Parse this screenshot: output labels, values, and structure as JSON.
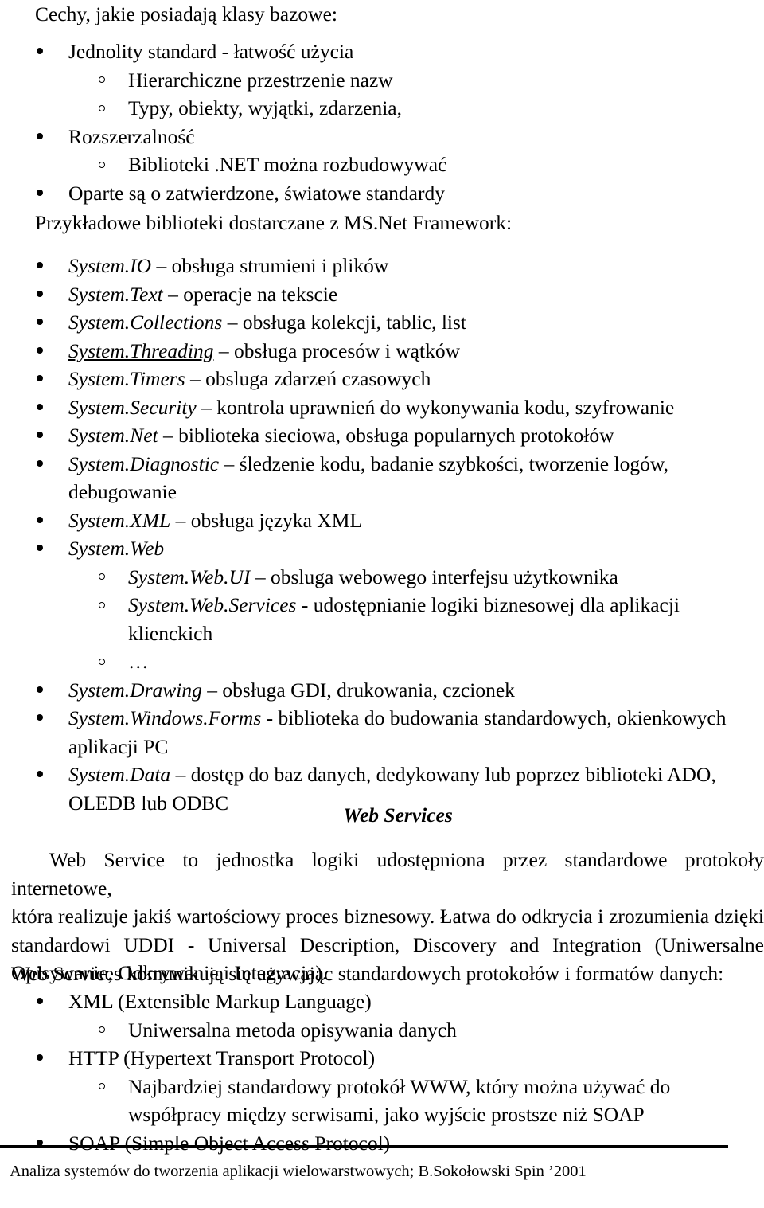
{
  "document": {
    "heading": "Cechy, jakie posiadają klasy bazowe:",
    "framework_intro": "Przykładowe biblioteki dostarczane z MS.Net Framework:",
    "features": [
      {
        "level": 1,
        "text": "Jednolity standard - łatwość użycia"
      },
      {
        "level": 2,
        "text": "Hierarchiczne przestrzenie nazw"
      },
      {
        "level": 2,
        "text": "Typy, obiekty, wyjątki, zdarzenia,"
      },
      {
        "level": 1,
        "text": "Rozszerzalność"
      },
      {
        "level": 2,
        "text": "Biblioteki .NET można rozbudowywać"
      },
      {
        "level": 1,
        "text": "Oparte są o zatwierdzone, światowe standardy"
      }
    ],
    "libraries": [
      {
        "level": 1,
        "name": "System.IO",
        "style": "italic",
        "desc": " – obsługa strumieni i plików"
      },
      {
        "level": 1,
        "name": "System.Text",
        "style": "italic",
        "desc": " – operacje na tekscie"
      },
      {
        "level": 1,
        "name": "System.Collections",
        "style": "italic",
        "desc": " – obsługa kolekcji, tablic, list"
      },
      {
        "level": 1,
        "name": "System.Threading",
        "style": "italic-underline",
        "desc": " – obsługa procesów i wątków"
      },
      {
        "level": 1,
        "name": "System.Timers",
        "style": "italic",
        "desc": " – obsluga zdarzeń czasowych"
      },
      {
        "level": 1,
        "name": "System.Security",
        "style": "italic",
        "desc": " – kontrola uprawnień do wykonywania kodu, szyfrowanie"
      },
      {
        "level": 1,
        "name": "System.Net",
        "style": "italic",
        "desc": " – biblioteka sieciowa, obsługa popularnych protokołów"
      },
      {
        "level": 1,
        "name": "System.Diagnostic",
        "style": "italic",
        "desc": " – śledzenie kodu, badanie szybkości, tworzenie logów, debugowanie"
      },
      {
        "level": 1,
        "name": "System.XML",
        "style": "italic",
        "desc": " – obsługa języka XML"
      },
      {
        "level": 1,
        "name": "System.Web",
        "style": "italic",
        "desc": ""
      },
      {
        "level": 2,
        "name": "System.Web.UI",
        "style": "italic",
        "desc": " – obsluga webowego interfejsu użytkownika"
      },
      {
        "level": 2,
        "name": "System.Web.Services",
        "style": "italic",
        "desc": "  - udostępnianie logiki biznesowej dla aplikacji klienckich"
      },
      {
        "level": 2,
        "name": "",
        "style": "plain",
        "desc": "…"
      },
      {
        "level": 1,
        "name": "System.Drawing",
        "style": "italic",
        "desc": " – obsługa GDI, drukowania, czcionek"
      },
      {
        "level": 1,
        "name": "System.Windows.Forms",
        "style": "italic",
        "desc": " - biblioteka do budowania standardowych, okienkowych aplikacji PC"
      },
      {
        "level": 1,
        "name": "System.Data",
        "style": "italic",
        "desc": " – dostęp do baz danych, dedykowany lub poprzez biblioteki ADO, OLEDB lub ODBC"
      }
    ],
    "web_services": {
      "title": "Web Services",
      "paragraph_lines": [
        "Web Service to jednostka logiki udostępniona przez standardowe protokoły internetowe,",
        "która realizuje jakiś wartościowy proces biznesowy. Łatwa do odkrycia i zrozumienia dzięki",
        "standardowi UDDI - Universal Description, Discovery and Integration (Uniwersalne",
        "Opisywanie, Odkrywanie i Integracja)."
      ],
      "intro2": "Web Services komunikują się używając standardowych protokołów i formatów danych:",
      "protocols": [
        {
          "level": 1,
          "text": "XML (Extensible Markup Language)"
        },
        {
          "level": 2,
          "text": "Uniwersalna metoda opisywania danych"
        },
        {
          "level": 1,
          "text": "HTTP (Hypertext Transport Protocol)"
        },
        {
          "level": 2,
          "text": "Najbardziej standardowy protokół WWW, który można używać do współpracy między serwisami, jako wyjście prostsze niż SOAP"
        },
        {
          "level": 1,
          "text": "SOAP (Simple Object Access Protocol)"
        }
      ]
    },
    "footer": {
      "text": "Analiza systemów do tworzenia aplikacji wielowarstwowych;   B.Sokołowski  Spin ’2001"
    }
  }
}
